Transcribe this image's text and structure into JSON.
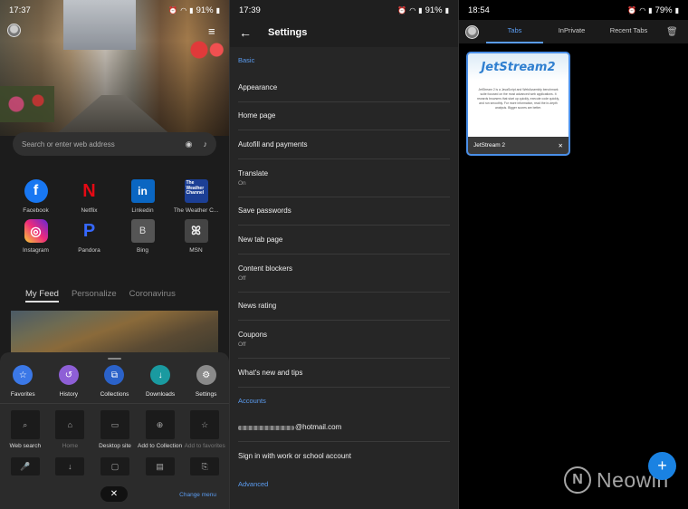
{
  "left": {
    "status": {
      "time": "17:37",
      "battery": "91%"
    },
    "search": {
      "placeholder": "Search or enter web address"
    },
    "top_sites": [
      {
        "label": "Facebook",
        "glyph": "f",
        "logo": "fb"
      },
      {
        "label": "Netflix",
        "glyph": "N",
        "logo": "nf"
      },
      {
        "label": "Linkedin",
        "glyph": "in",
        "logo": "li"
      },
      {
        "label": "The Weather C...",
        "glyph": "The Weather Channel",
        "logo": "tw"
      },
      {
        "label": "Instagram",
        "glyph": "◎",
        "logo": "ig"
      },
      {
        "label": "Pandora",
        "glyph": "P",
        "logo": "pd"
      },
      {
        "label": "Bing",
        "glyph": "B",
        "logo": "bg"
      },
      {
        "label": "MSN",
        "glyph": "ꕤ",
        "logo": "ms"
      }
    ],
    "feed_tabs": [
      "My Feed",
      "Personalize",
      "Coronavirus"
    ],
    "menu_top": [
      {
        "label": "Favorites",
        "icon": "star-icon",
        "glyph": "☆",
        "color": "#3b78e7"
      },
      {
        "label": "History",
        "icon": "history-icon",
        "glyph": "↺",
        "color": "#8e5fd6"
      },
      {
        "label": "Collections",
        "icon": "collections-icon",
        "glyph": "⧉",
        "color": "#2b62c9"
      },
      {
        "label": "Downloads",
        "icon": "download-icon",
        "glyph": "↓",
        "color": "#1a9aa0"
      },
      {
        "label": "Settings",
        "icon": "gear-icon",
        "glyph": "⚙",
        "color": "#8a8a8a"
      }
    ],
    "menu_grid": [
      {
        "label": "Web search",
        "icon": "search-icon",
        "glyph": "⌕",
        "dim": false
      },
      {
        "label": "Home",
        "icon": "home-icon",
        "glyph": "⌂",
        "dim": true
      },
      {
        "label": "Desktop site",
        "icon": "desktop-icon",
        "glyph": "▭",
        "dim": false
      },
      {
        "label": "Add to Collection",
        "icon": "add-collection-icon",
        "glyph": "⊕",
        "dim": false
      },
      {
        "label": "Add to favorites",
        "icon": "add-favorite-icon",
        "glyph": "☆",
        "dim": true
      },
      {
        "label": "",
        "icon": "microphone-icon",
        "glyph": "🎤",
        "dim": false
      },
      {
        "label": "",
        "icon": "download-arrow-icon",
        "glyph": "↓",
        "dim": false
      },
      {
        "label": "",
        "icon": "note-icon",
        "glyph": "▢",
        "dim": false
      },
      {
        "label": "",
        "icon": "page-icon",
        "glyph": "▤",
        "dim": false
      },
      {
        "label": "",
        "icon": "share-page-icon",
        "glyph": "⎘",
        "dim": false
      }
    ],
    "change_menu": "Change menu"
  },
  "middle": {
    "status": {
      "time": "17:39",
      "battery": "91%"
    },
    "title": "Settings",
    "sections": [
      {
        "header": "Basic",
        "items": [
          {
            "title": "Appearance",
            "sub": ""
          },
          {
            "title": "Home page",
            "sub": ""
          },
          {
            "title": "Autofill and payments",
            "sub": ""
          },
          {
            "title": "Translate",
            "sub": "On"
          },
          {
            "title": "Save passwords",
            "sub": ""
          },
          {
            "title": "New tab page",
            "sub": ""
          },
          {
            "title": "Content blockers",
            "sub": "Off"
          },
          {
            "title": "News rating",
            "sub": ""
          },
          {
            "title": "Coupons",
            "sub": "Off"
          },
          {
            "title": "What's new and tips",
            "sub": ""
          }
        ]
      },
      {
        "header": "Accounts",
        "items": [
          {
            "title": "@hotmail.com",
            "sub": "",
            "redacted": true
          },
          {
            "title": "Sign in with work or school account",
            "sub": ""
          }
        ]
      },
      {
        "header": "Advanced",
        "items": []
      }
    ]
  },
  "right": {
    "status": {
      "time": "18:54",
      "battery": "79%"
    },
    "tabs": [
      "Tabs",
      "InPrivate",
      "Recent Tabs"
    ],
    "active_tab": 0,
    "tab_card": {
      "logo": "JetStream2",
      "body": "JetStream 2 is a JavaScript and WebAssembly benchmark suite focused on the most advanced web applications. It rewards browsers that start up quickly, execute code quickly, and run smoothly. For more information, read the in-depth analysis. Bigger scores are better.",
      "title": "JetStream 2"
    },
    "fab_glyph": "+",
    "watermark": "Neowin",
    "watermark_mark": "N"
  }
}
